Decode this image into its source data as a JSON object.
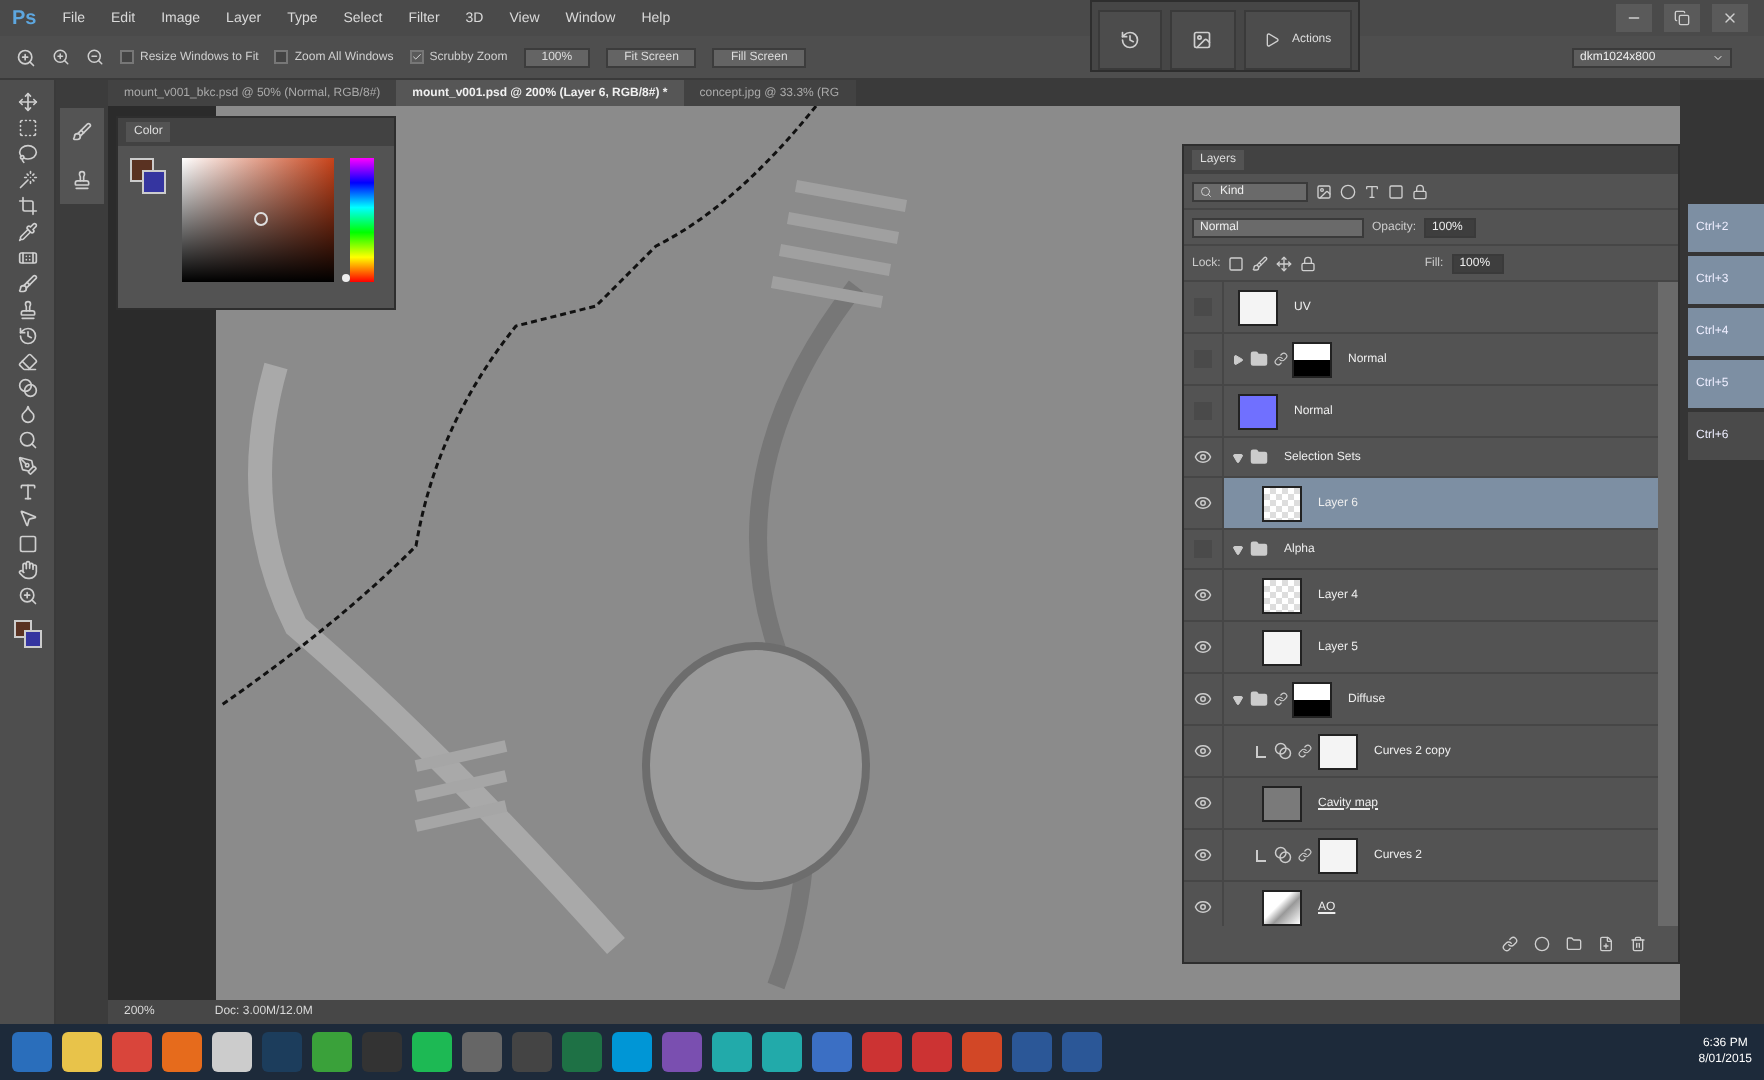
{
  "app": {
    "logo": "Ps"
  },
  "menu": [
    "File",
    "Edit",
    "Image",
    "Layer",
    "Type",
    "Select",
    "Filter",
    "3D",
    "View",
    "Window",
    "Help"
  ],
  "options_bar": {
    "checkboxes": [
      {
        "label": "Resize Windows to Fit",
        "checked": false
      },
      {
        "label": "Zoom All Windows",
        "checked": false
      },
      {
        "label": "Scrubby Zoom",
        "checked": true
      }
    ],
    "buttons": [
      "100%",
      "Fit Screen",
      "Fill Screen"
    ],
    "workspace": "dkm1024x800"
  },
  "mini_panels": {
    "actions_label": "Actions"
  },
  "document_tabs": [
    {
      "label": "mount_v001_bkc.psd @ 50% (Normal, RGB/8#)",
      "selected": false
    },
    {
      "label": "mount_v001.psd @ 200% (Layer 6, RGB/8#) *",
      "selected": true
    },
    {
      "label": "concept.jpg @ 33.3% (RG",
      "selected": false
    }
  ],
  "color_panel": {
    "title": "Color",
    "hue_slider": {
      "level": 0.04
    }
  },
  "layers_panel": {
    "title": "Layers",
    "filter": "Kind",
    "blend_mode": "Normal",
    "opacity_label": "Opacity:",
    "opacity": "100%",
    "lock_label": "Lock:",
    "fill_label": "Fill:",
    "fill": "100%",
    "layers": [
      {
        "name": "UV",
        "kind": "plain",
        "visible": false,
        "selected": false,
        "clipped": false,
        "underlined": false
      },
      {
        "name": "Normal",
        "kind": "group",
        "mask": true,
        "expanded": false,
        "visible": false,
        "selected": false,
        "clipped": false,
        "underlined": false
      },
      {
        "name": "Normal",
        "kind": "fill",
        "color": "#7070ff",
        "visible": false,
        "selected": false,
        "clipped": false,
        "underlined": false
      },
      {
        "name": "Selection Sets",
        "kind": "group",
        "mask": false,
        "expanded": true,
        "visible": true,
        "selected": false,
        "clipped": false,
        "underlined": false,
        "children": [
          {
            "name": "Layer 6",
            "kind": "transparent",
            "visible": true,
            "selected": true,
            "clipped": false,
            "underlined": false
          }
        ]
      },
      {
        "name": "Alpha",
        "kind": "group",
        "mask": false,
        "expanded": true,
        "visible": false,
        "selected": false,
        "clipped": false,
        "underlined": false,
        "children": [
          {
            "name": "Layer 4",
            "kind": "transparent",
            "visible": true,
            "selected": false,
            "clipped": false,
            "underlined": false
          },
          {
            "name": "Layer 5",
            "kind": "plain",
            "visible": true,
            "selected": false,
            "clipped": false,
            "underlined": false
          }
        ]
      },
      {
        "name": "Diffuse",
        "kind": "group",
        "mask": true,
        "expanded": true,
        "visible": true,
        "selected": false,
        "clipped": false,
        "underlined": false,
        "children": [
          {
            "name": "Curves 2 copy",
            "kind": "adjustment",
            "visible": true,
            "selected": false,
            "clipped": true,
            "underlined": false
          },
          {
            "name": "Cavity map",
            "kind": "fill",
            "color": "#7a7a7a",
            "visible": true,
            "selected": false,
            "clipped": false,
            "underlined": true
          },
          {
            "name": "Curves 2",
            "kind": "adjustment",
            "visible": true,
            "selected": false,
            "clipped": true,
            "underlined": false
          },
          {
            "name": "AO",
            "kind": "texture",
            "visible": true,
            "selected": false,
            "clipped": false,
            "underlined": true
          }
        ]
      }
    ]
  },
  "shortcuts": [
    "Ctrl+2",
    "Ctrl+3",
    "Ctrl+4",
    "Ctrl+5",
    "Ctrl+6"
  ],
  "status_bar": {
    "zoom": "200%",
    "doc": "Doc: 3.00M/12.0M"
  },
  "taskbar": {
    "time": "6:36 PM",
    "date": "8/01/2015"
  }
}
